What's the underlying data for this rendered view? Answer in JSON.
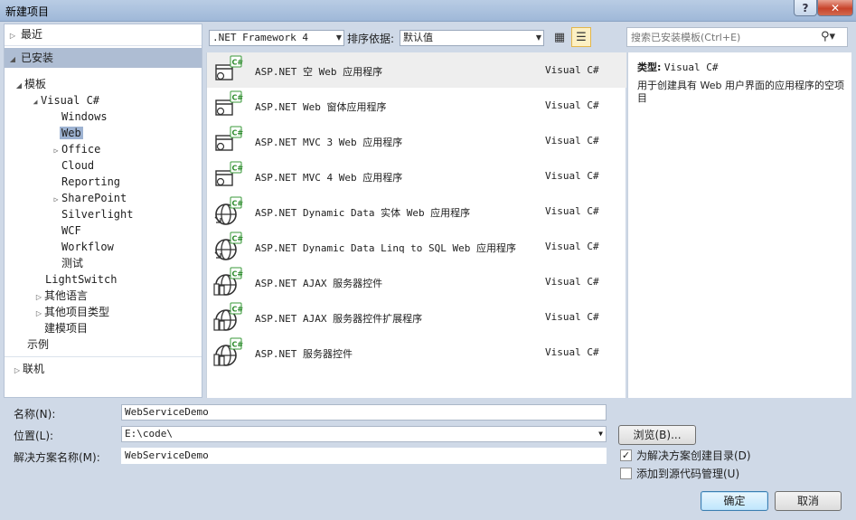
{
  "window": {
    "title": "新建项目",
    "help": "?",
    "close": "✕"
  },
  "tree": {
    "recent": "最近",
    "installed": "已安装",
    "templates": "模板",
    "visual_csharp": "Visual C#",
    "children": [
      "Windows",
      "Web",
      "Office",
      "Cloud",
      "Reporting",
      "SharePoint",
      "Silverlight",
      "WCF",
      "Workflow",
      "测试"
    ],
    "lightswitch": "LightSwitch",
    "other_languages": "其他语言",
    "other_project_types": "其他项目类型",
    "modeling_projects": "建模项目",
    "samples": "示例",
    "online": "联机"
  },
  "toolbar": {
    "framework": ".NET Framework 4",
    "sort_label": "排序依据:",
    "sort_value": "默认值"
  },
  "search": {
    "placeholder": "搜索已安装模板(Ctrl+E)"
  },
  "templates": [
    {
      "name": "ASP.NET 空 Web 应用程序",
      "lang": "Visual C#"
    },
    {
      "name": "ASP.NET Web 窗体应用程序",
      "lang": "Visual C#"
    },
    {
      "name": "ASP.NET MVC 3 Web 应用程序",
      "lang": "Visual C#"
    },
    {
      "name": "ASP.NET MVC 4 Web 应用程序",
      "lang": "Visual C#"
    },
    {
      "name": "ASP.NET Dynamic Data 实体 Web 应用程序",
      "lang": "Visual C#"
    },
    {
      "name": "ASP.NET Dynamic Data Linq to SQL Web 应用程序",
      "lang": "Visual C#"
    },
    {
      "name": "ASP.NET AJAX 服务器控件",
      "lang": "Visual C#"
    },
    {
      "name": "ASP.NET AJAX 服务器控件扩展程序",
      "lang": "Visual C#"
    },
    {
      "name": "ASP.NET 服务器控件",
      "lang": "Visual C#"
    }
  ],
  "details": {
    "type_label": "类型:",
    "type_value": "Visual C#",
    "description": "用于创建具有 Web 用户界面的应用程序的空项目"
  },
  "form": {
    "name_label": "名称(N):",
    "name_value": "WebServiceDemo",
    "location_label": "位置(L):",
    "location_value": "E:\\code\\",
    "solution_label": "解决方案名称(M):",
    "solution_value": "WebServiceDemo",
    "browse": "浏览(B)...",
    "create_dir_label": "为解决方案创建目录(D)",
    "create_dir_checked": true,
    "source_control_label": "添加到源代码管理(U)",
    "source_control_checked": false,
    "ok": "确定",
    "cancel": "取消"
  }
}
